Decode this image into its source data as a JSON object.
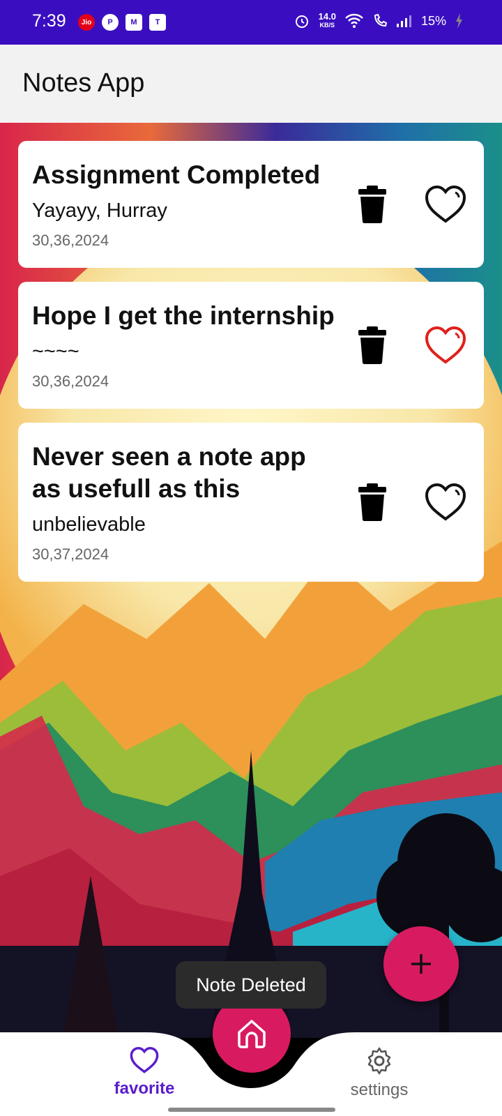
{
  "status_bar": {
    "time": "7:39",
    "left_icons": [
      "Jio",
      "P",
      "M",
      "T"
    ],
    "net_speed_value": "14.0",
    "net_speed_unit": "KB/S",
    "battery": "15%"
  },
  "app_bar": {
    "title": "Notes App"
  },
  "notes": [
    {
      "title": "Assignment Completed",
      "body": "Yayayy, Hurray",
      "date": "30,36,2024",
      "favorite": false
    },
    {
      "title": "Hope I get the internship",
      "body": "~~~~",
      "date": "30,36,2024",
      "favorite": true
    },
    {
      "title": "Never seen a note app as usefull as this",
      "body": "unbelievable",
      "date": "30,37,2024",
      "favorite": false
    }
  ],
  "fab": {
    "icon": "plus-icon"
  },
  "toast": {
    "text": "Note Deleted"
  },
  "bottom_nav": {
    "favorite_label": "favorite",
    "settings_label": "settings",
    "home_icon": "home-icon"
  },
  "colors": {
    "status_bar": "#3a0ec0",
    "accent": "#d81b60",
    "nav_active": "#5a1ccc",
    "heart_active": "#e0201b"
  }
}
